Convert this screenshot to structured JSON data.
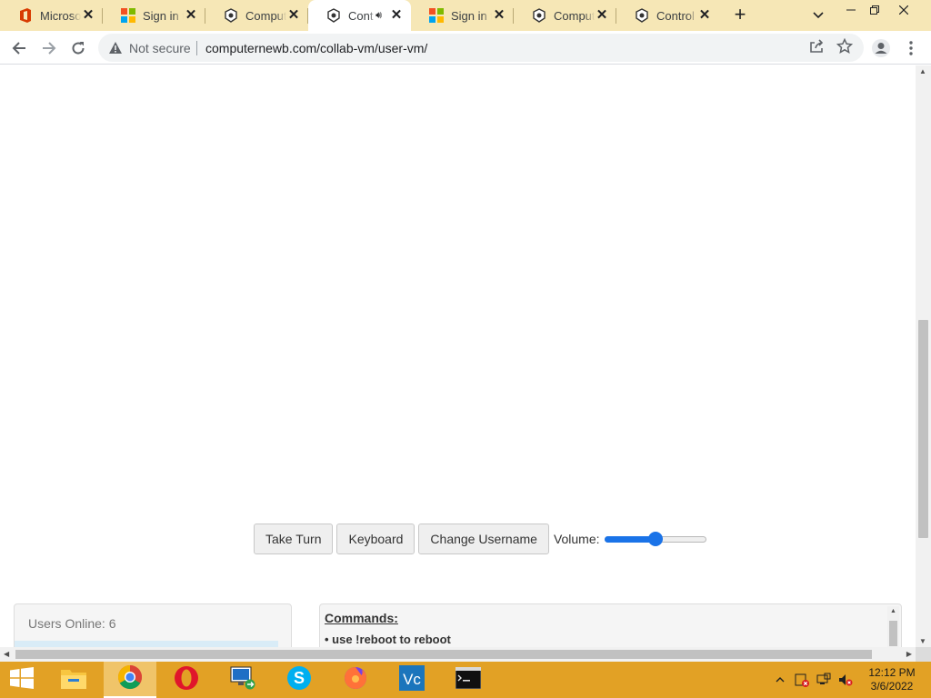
{
  "browser": {
    "tabs": [
      {
        "title": "Microsoft",
        "icon": "office-icon",
        "active": false
      },
      {
        "title": "Sign in to",
        "icon": "microsoft-icon",
        "active": false
      },
      {
        "title": "Compute",
        "icon": "computernewb-icon",
        "active": false
      },
      {
        "title": "Cont",
        "icon": "computernewb-icon",
        "active": true,
        "audio": true
      },
      {
        "title": "Sign in to",
        "icon": "microsoft-icon",
        "active": false
      },
      {
        "title": "Compute",
        "icon": "computernewb-icon",
        "active": false
      },
      {
        "title": "Control C",
        "icon": "computernewb-icon",
        "active": false
      }
    ],
    "security_label": "Not secure",
    "url": "computernewb.com/collab-vm/user-vm/"
  },
  "vm_controls": {
    "take_turn": "Take Turn",
    "keyboard": "Keyboard",
    "change_username": "Change Username",
    "volume_label": "Volume:",
    "volume_level": 0.5
  },
  "users_panel": {
    "title": "Users Online: 6"
  },
  "commands_panel": {
    "title": "Commands:",
    "items": [
      "• use !reboot to reboot"
    ]
  },
  "taskbar": {
    "apps": [
      "file-explorer-icon",
      "chrome-icon",
      "opera-icon",
      "remote-desktop-icon",
      "skype-icon",
      "firefox-icon",
      "vmware-icon",
      "cmd-icon"
    ],
    "time": "12:12 PM",
    "date": "3/6/2022"
  },
  "colors": {
    "tabstrip": "#f6e7b6",
    "taskbar": "#e2a125",
    "accent": "#1a73e8"
  }
}
